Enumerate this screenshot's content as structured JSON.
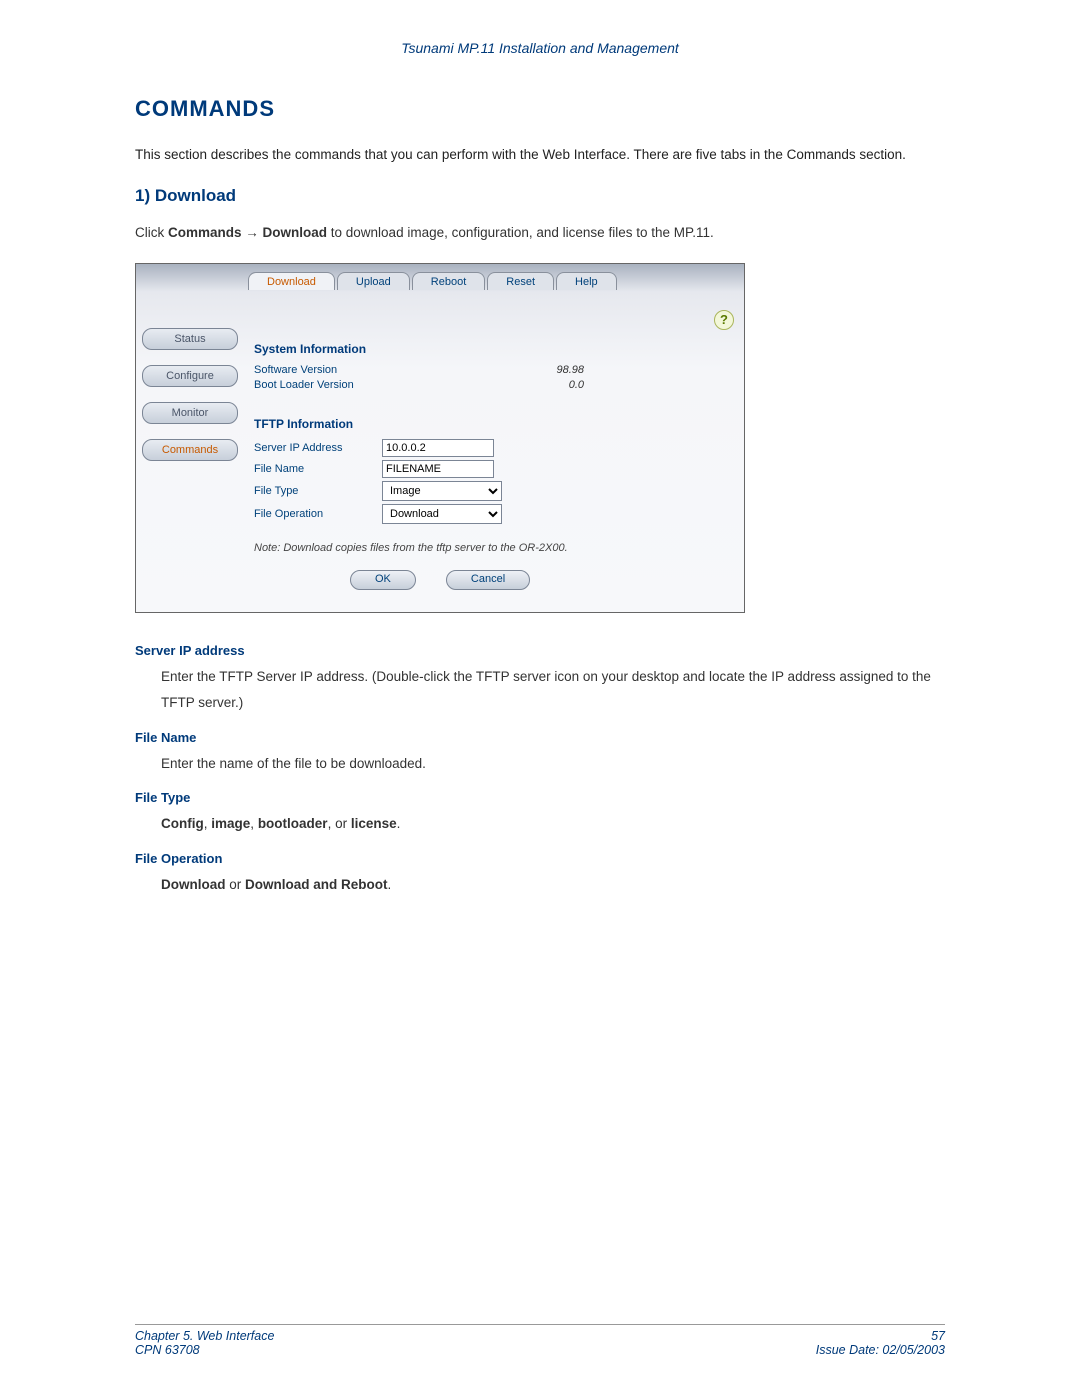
{
  "doc_header": "Tsunami MP.11 Installation and Management",
  "section_title": "COMMANDS",
  "intro": "This section describes the commands that you can perform with the Web Interface.  There are five tabs in the Commands section.",
  "sub_title": "1) Download",
  "click_prefix": "Click ",
  "click_bold": "Commands → Download",
  "click_suffix": " to download image, configuration, and license files to the MP.11.",
  "screenshot": {
    "tabs": {
      "download": "Download",
      "upload": "Upload",
      "reboot": "Reboot",
      "reset": "Reset",
      "help": "Help"
    },
    "help_icon": "?",
    "sidenav": {
      "status": "Status",
      "configure": "Configure",
      "monitor": "Monitor",
      "commands": "Commands"
    },
    "sysinfo_heading": "System Information",
    "sw_version_label": "Software Version",
    "sw_version_value": "98.98",
    "bl_version_label": "Boot Loader Version",
    "bl_version_value": "0.0",
    "tftp_heading": "TFTP Information",
    "server_ip_label": "Server IP Address",
    "server_ip_value": "10.0.0.2",
    "file_name_label": "File Name",
    "file_name_value": "FILENAME",
    "file_type_label": "File Type",
    "file_type_value": "Image",
    "file_op_label": "File Operation",
    "file_op_value": "Download",
    "note": "Note: Download copies files from the tftp server to the OR-2X00.",
    "ok": "OK",
    "cancel": "Cancel"
  },
  "defs": {
    "server_ip_term": "Server IP address",
    "server_ip_body": "Enter the TFTP Server IP address.  (Double-click the TFTP server icon on your desktop and locate the IP address assigned to the TFTP server.)",
    "file_name_term": "File Name",
    "file_name_body": "Enter the name of the file to be downloaded.",
    "file_type_term": "File Type",
    "file_type_body_b1": "Config",
    "file_type_body_s1": ", ",
    "file_type_body_b2": "image",
    "file_type_body_s2": ", ",
    "file_type_body_b3": "bootloader",
    "file_type_body_s3": ", or ",
    "file_type_body_b4": "license",
    "file_type_body_s4": ".",
    "file_op_term": "File Operation",
    "file_op_b1": "Download",
    "file_op_s1": " or ",
    "file_op_b2": "Download and Reboot",
    "file_op_s2": "."
  },
  "footer": {
    "chapter": "Chapter 5.  Web Interface",
    "cpn": "CPN 63708",
    "page": "57",
    "issue": "Issue Date:  02/05/2003"
  }
}
